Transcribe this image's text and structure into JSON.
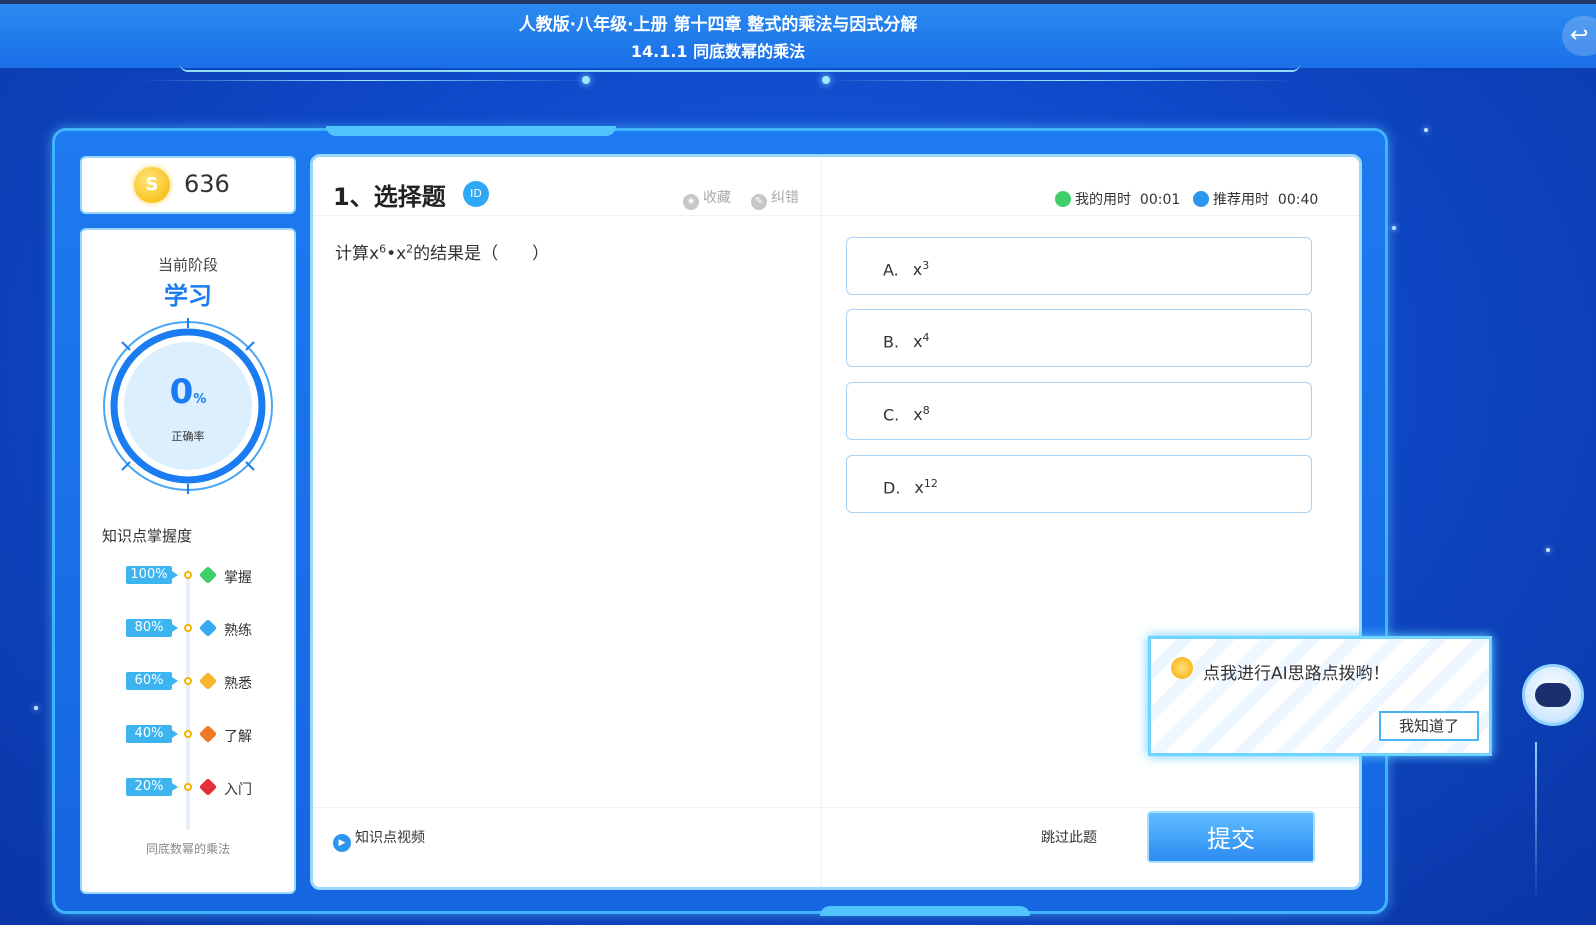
{
  "header": {
    "title": "人教版·八年级·上册  第十四章 整式的乘法与因式分解",
    "subtitle": "14.1.1 同底数幂的乘法"
  },
  "coins": {
    "value": "636",
    "icon": "coin-icon"
  },
  "stage": {
    "label": "当前阶段",
    "value": "学习",
    "accuracy_value": "0",
    "accuracy_unit": "%",
    "accuracy_label": "正确率",
    "accuracy_fraction": 0
  },
  "mastery": {
    "title": "知识点掌握度",
    "levels": [
      {
        "pct": "100%",
        "label": "掌握",
        "color": "#3fcf6a"
      },
      {
        "pct": "80%",
        "label": "熟练",
        "color": "#36a9f2"
      },
      {
        "pct": "60%",
        "label": "熟悉",
        "color": "#f6b52b"
      },
      {
        "pct": "40%",
        "label": "了解",
        "color": "#f07a25"
      },
      {
        "pct": "20%",
        "label": "入门",
        "color": "#e5313a"
      }
    ],
    "footer": "同底数幂的乘法"
  },
  "question": {
    "title": "1、选择题",
    "id_badge": "ID",
    "favorite": "收藏",
    "report": "纠错",
    "my_time_label": "我的用时",
    "my_time": "00:01",
    "recommend_label": "推荐用时",
    "recommend_time": "00:40",
    "text_prefix": "计算x",
    "exp1": "6",
    "mid": "•x",
    "exp2": "2",
    "text_suffix": "的结果是（　　）"
  },
  "options": [
    {
      "letter": "A.",
      "base": "x",
      "exp": "3"
    },
    {
      "letter": "B.",
      "base": "x",
      "exp": "4"
    },
    {
      "letter": "C.",
      "base": "x",
      "exp": "8"
    },
    {
      "letter": "D.",
      "base": "x",
      "exp": "12"
    }
  ],
  "footer": {
    "video": "知识点视频",
    "skip": "跳过此题",
    "submit": "提交"
  },
  "ai_tip": {
    "text": "点我进行AI思路点拨哟！",
    "button": "我知道了"
  },
  "colors": {
    "accent": "#1a7cf0",
    "background": "#0f49c9",
    "submit": "#2c8cf2"
  }
}
